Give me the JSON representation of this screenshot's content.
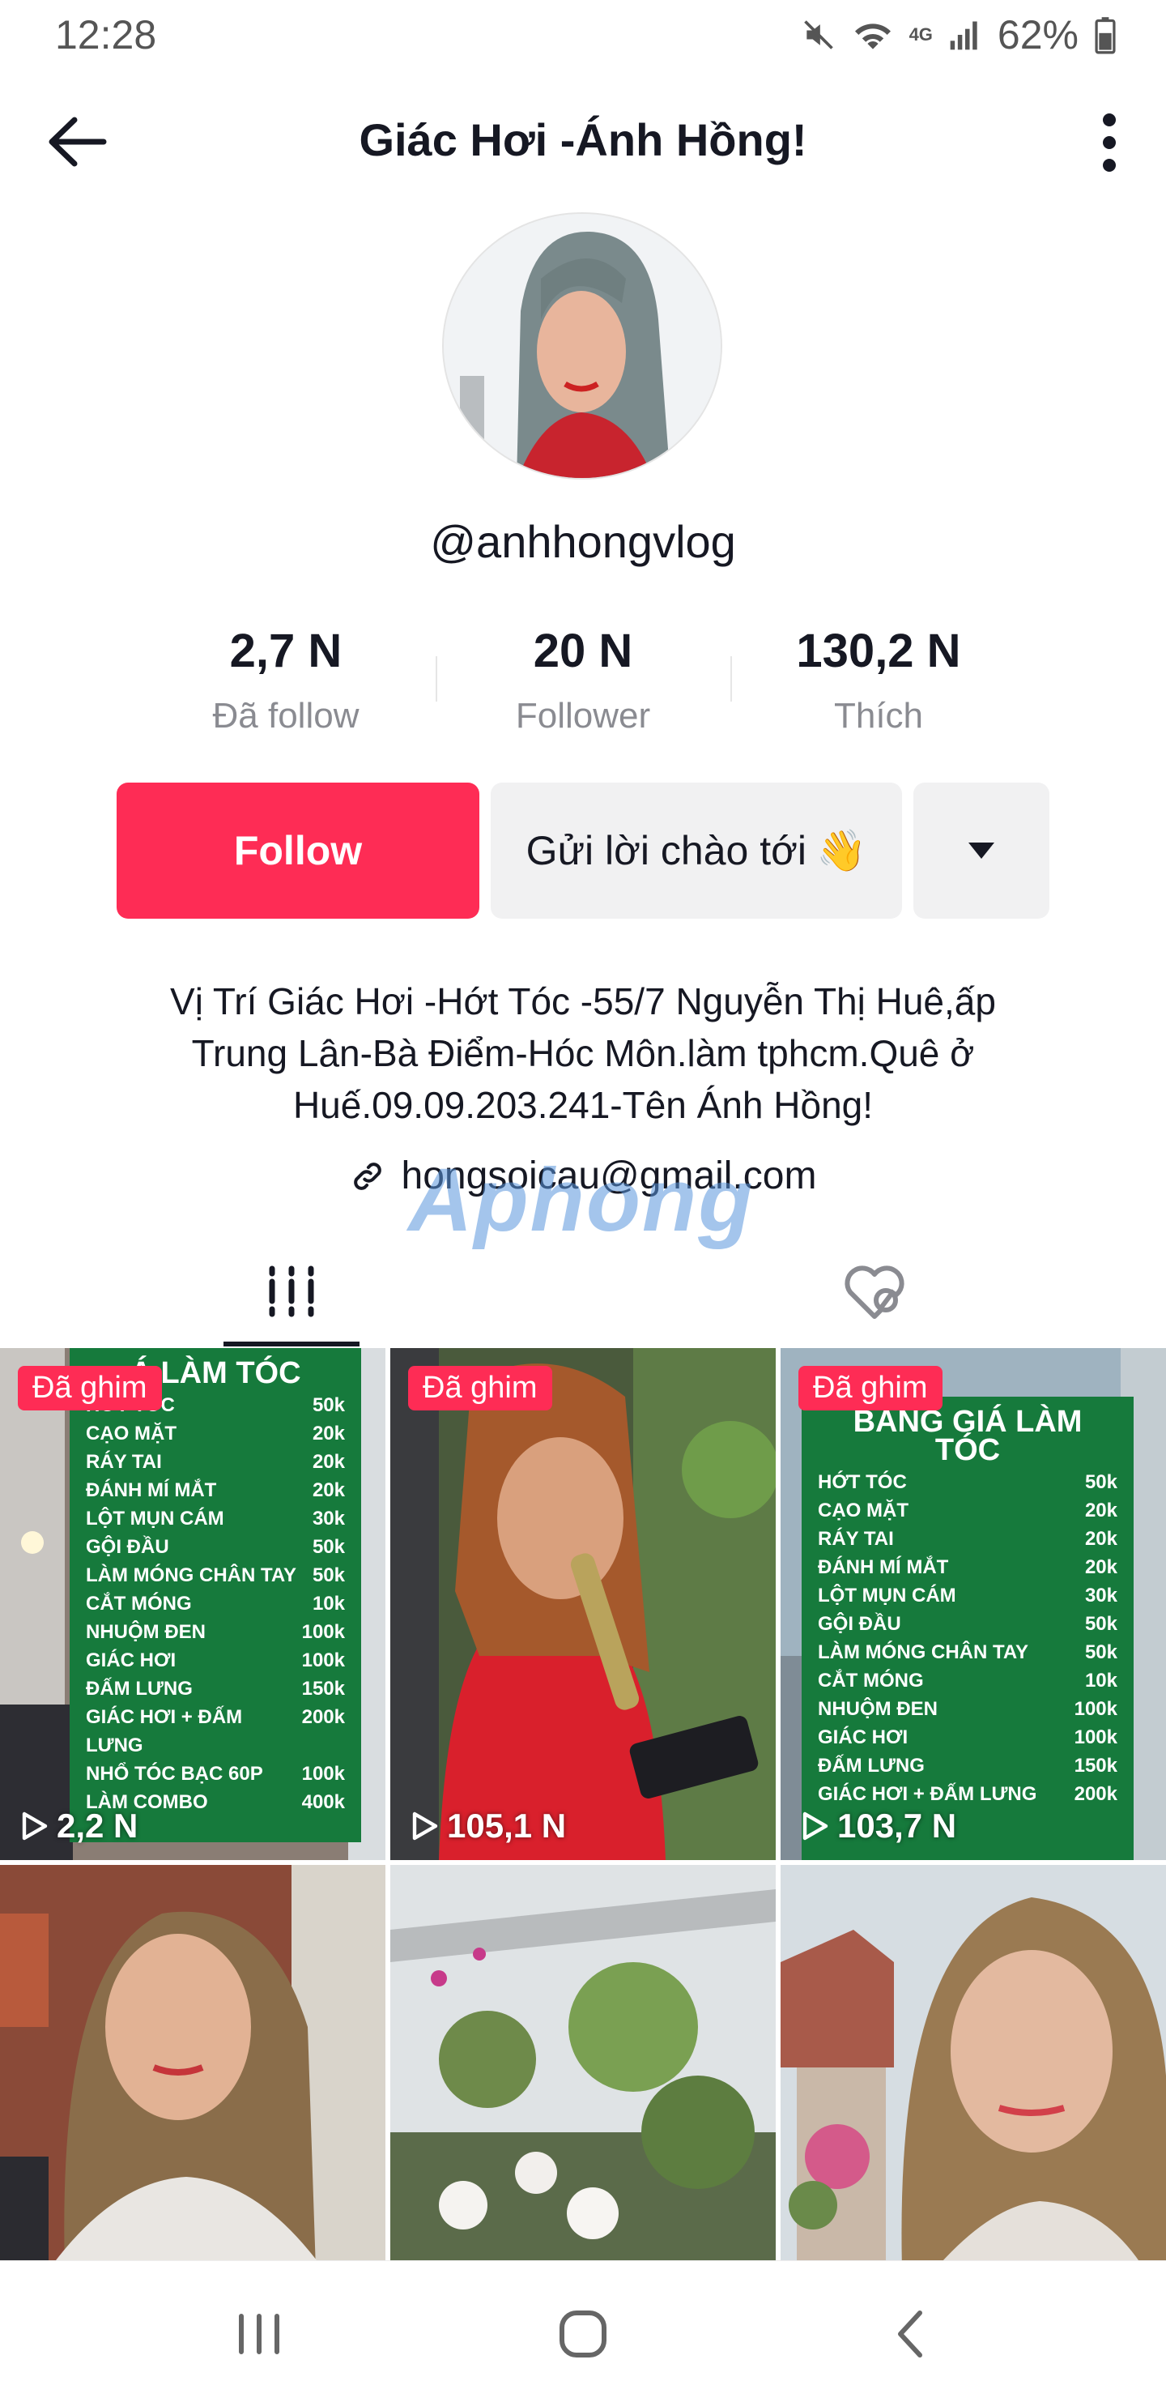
{
  "status_bar": {
    "time": "12:28",
    "network": "4G",
    "battery": "62%"
  },
  "header": {
    "title": "Giác Hơi -Ánh Hồng!"
  },
  "profile": {
    "handle": "@anhhongvlog",
    "stats": [
      {
        "value": "2,7 N",
        "label": "Đã follow"
      },
      {
        "value": "20 N",
        "label": "Follower"
      },
      {
        "value": "130,2 N",
        "label": "Thích"
      }
    ],
    "follow_label": "Follow",
    "hello_label": "Gửi lời chào tới",
    "hello_emoji": "👋",
    "bio_lines": [
      "Vị Trí  Giác Hơi -Hớt Tóc -55/7 Nguyễn Thị Huê,ấp",
      "Trung Lân-Bà Điểm-Hóc Môn.làm tphcm.Quê ở",
      "Huế.09.09.203.241-Tên Ánh Hồng!"
    ],
    "link": "hongsoicau@gmail.com",
    "watermark": "Aphong"
  },
  "accent_color": "#fe2c55",
  "videos": [
    {
      "pin": "Đã ghim",
      "views": "2,2 N",
      "board": {
        "head": "Á LÀM TÓC",
        "rows": [
          [
            "HỚT TÓC",
            "50k"
          ],
          [
            "CẠO MẶT",
            "20k"
          ],
          [
            "RÁY TAI",
            "20k"
          ],
          [
            "ĐÁNH MÍ MẮT",
            "20k"
          ],
          [
            "LỘT MỤN CÁM",
            "30k"
          ],
          [
            "GỘI ĐẦU",
            "50k"
          ],
          [
            "LÀM MÓNG CHÂN TAY",
            "50k"
          ],
          [
            "CẮT MÓNG",
            "10k"
          ],
          [
            "NHUỘM ĐEN",
            "100k"
          ],
          [
            "GIÁC HƠI",
            "100k"
          ],
          [
            "ĐẤM LƯNG",
            "150k"
          ],
          [
            "GIÁC HƠI + ĐẤM LƯNG",
            "200k"
          ],
          [
            "NHỔ TÓC BẠC 60P",
            "100k"
          ],
          [
            "LÀM COMBO",
            "400k"
          ]
        ]
      }
    },
    {
      "pin": "Đã ghim",
      "views": "105,1 N"
    },
    {
      "pin": "Đã ghim",
      "views": "103,7 N",
      "board": {
        "head": "BẢNG GIÁ LÀM TÓC",
        "rows": [
          [
            "HỚT TÓC",
            "50k"
          ],
          [
            "CẠO MẶT",
            "20k"
          ],
          [
            "RÁY TAI",
            "20k"
          ],
          [
            "ĐÁNH MÍ MẮT",
            "20k"
          ],
          [
            "LỘT MỤN CÁM",
            "30k"
          ],
          [
            "GỘI ĐẦU",
            "50k"
          ],
          [
            "LÀM MÓNG CHÂN TAY",
            "50k"
          ],
          [
            "CẮT MÓNG",
            "10k"
          ],
          [
            "NHUỘM ĐEN",
            "100k"
          ],
          [
            "GIÁC HƠI",
            "100k"
          ],
          [
            "ĐẤM LƯNG",
            "150k"
          ],
          [
            "GIÁC HƠI + ĐẤM LƯNG",
            "200k"
          ]
        ]
      }
    },
    {},
    {},
    {}
  ]
}
